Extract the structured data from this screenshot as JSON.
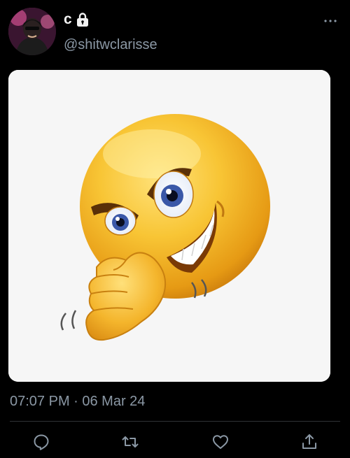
{
  "tweet": {
    "display_name": "c",
    "handle": "@shitwclarisse",
    "timestamp": "07:07 PM · 06 Mar 24"
  },
  "icons": {
    "avatar": "profile-avatar",
    "lock": "lock-icon",
    "more": "more-options-icon",
    "reply": "reply-icon",
    "retweet": "retweet-icon",
    "like": "heart-icon",
    "share": "share-icon"
  },
  "colors": {
    "background": "#000000",
    "text_primary": "#e7e9ea",
    "text_secondary": "#8b98a5",
    "divider": "#2f3336"
  }
}
